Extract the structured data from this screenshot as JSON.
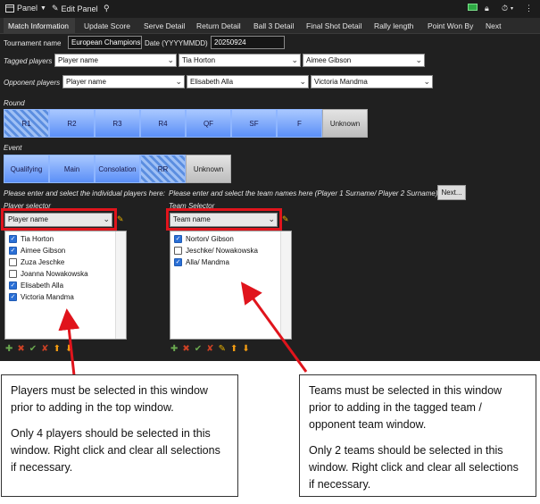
{
  "titlebar": {
    "panel_label": "Panel",
    "edit_panel_label": "Edit Panel"
  },
  "tabs": [
    "Match Information",
    "Update Score",
    "Serve Detail",
    "Return Detail",
    "Ball 3 Detail",
    "Final Shot Detail",
    "Rally length",
    "Point Won By",
    "Next"
  ],
  "tournament": {
    "label": "Tournament name",
    "value": "European Championsh",
    "date_label": "Date (YYYYMMDD)",
    "date_value": "20250924"
  },
  "tagged_players": {
    "label": "Tagged players",
    "values": [
      "Player name",
      "Tia Horton",
      "Aimee Gibson"
    ]
  },
  "opponent_players": {
    "label": "Opponent players",
    "values": [
      "Player name",
      "Elisabeth Alla",
      "Victoria Mandma"
    ]
  },
  "round": {
    "label": "Round",
    "options": [
      "R1",
      "R2",
      "R3",
      "R4",
      "QF",
      "SF",
      "F",
      "Unknown"
    ]
  },
  "event": {
    "label": "Event",
    "options": [
      "Qualifying",
      "Main",
      "Consolation",
      "RR",
      "Unknown"
    ]
  },
  "instructions": {
    "players_hint": "Please enter and select the individual players here:",
    "teams_hint": "Please enter and select the team names here (Player 1 Surname/ Player 2 Surname)",
    "next_button": "Next..."
  },
  "player_selector": {
    "label": "Player selector",
    "dropdown": "Player name",
    "items": [
      {
        "name": "Tia Horton",
        "checked": true
      },
      {
        "name": "Aimee Gibson",
        "checked": true
      },
      {
        "name": "Zuza Jeschke",
        "checked": false
      },
      {
        "name": "Joanna Nowakowska",
        "checked": false
      },
      {
        "name": "Elisabeth Alla",
        "checked": true
      },
      {
        "name": "Victoria Mandma",
        "checked": true
      }
    ]
  },
  "team_selector": {
    "label": "Team Selector",
    "dropdown": "Team name",
    "items": [
      {
        "name": "Norton/ Gibson",
        "checked": true
      },
      {
        "name": "Jeschke/ Nowakowska",
        "checked": false
      },
      {
        "name": "Alla/ Mandma",
        "checked": true
      }
    ]
  },
  "notes": {
    "players": [
      "Players must be selected in this window prior to adding in the top window.",
      "Only 4 players should be selected in this window. Right click and clear all selections if necessary."
    ],
    "teams": [
      "Teams must be selected in this window prior to adding in the tagged team / opponent team window.",
      "Only 2 teams should be selected in this window. Right click and clear all selections if necessary."
    ]
  },
  "colors": {
    "annotation_red": "#e0141c",
    "checkbox_blue": "#2a6fd6",
    "segment_blue": "#5b8ff7"
  }
}
